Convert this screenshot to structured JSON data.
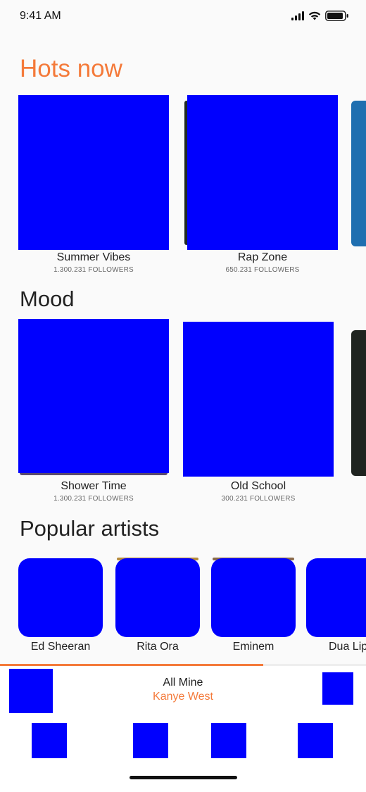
{
  "status_bar": {
    "time": "9:41 AM"
  },
  "sections": {
    "hots_now": {
      "title": "Hots now",
      "items": [
        {
          "label": "Summer Vibes",
          "followers": "1.300.231 FOLLOWERS"
        },
        {
          "label": "Rap Zone",
          "followers": "650.231 FOLLOWERS"
        }
      ]
    },
    "mood": {
      "title": "Mood",
      "items": [
        {
          "label": "Shower Time",
          "followers": "1.300.231 FOLLOWERS"
        },
        {
          "label": "Old School",
          "followers": "300.231 FOLLOWERS"
        }
      ]
    },
    "popular_artists": {
      "title": "Popular artists",
      "items": [
        {
          "name": "Ed Sheeran"
        },
        {
          "name": "Rita Ora"
        },
        {
          "name": "Eminem"
        },
        {
          "name": "Dua Lipa"
        }
      ]
    }
  },
  "player": {
    "title": "All Mine",
    "artist": "Kanye West",
    "progress": 0.72
  },
  "tab_bar": {
    "tabs": [
      "home-icon",
      "search-icon",
      "library-icon",
      "profile-icon"
    ]
  },
  "colors": {
    "accent": "#f47a3a",
    "placeholder": "#0000fe",
    "background": "#fafafa"
  }
}
